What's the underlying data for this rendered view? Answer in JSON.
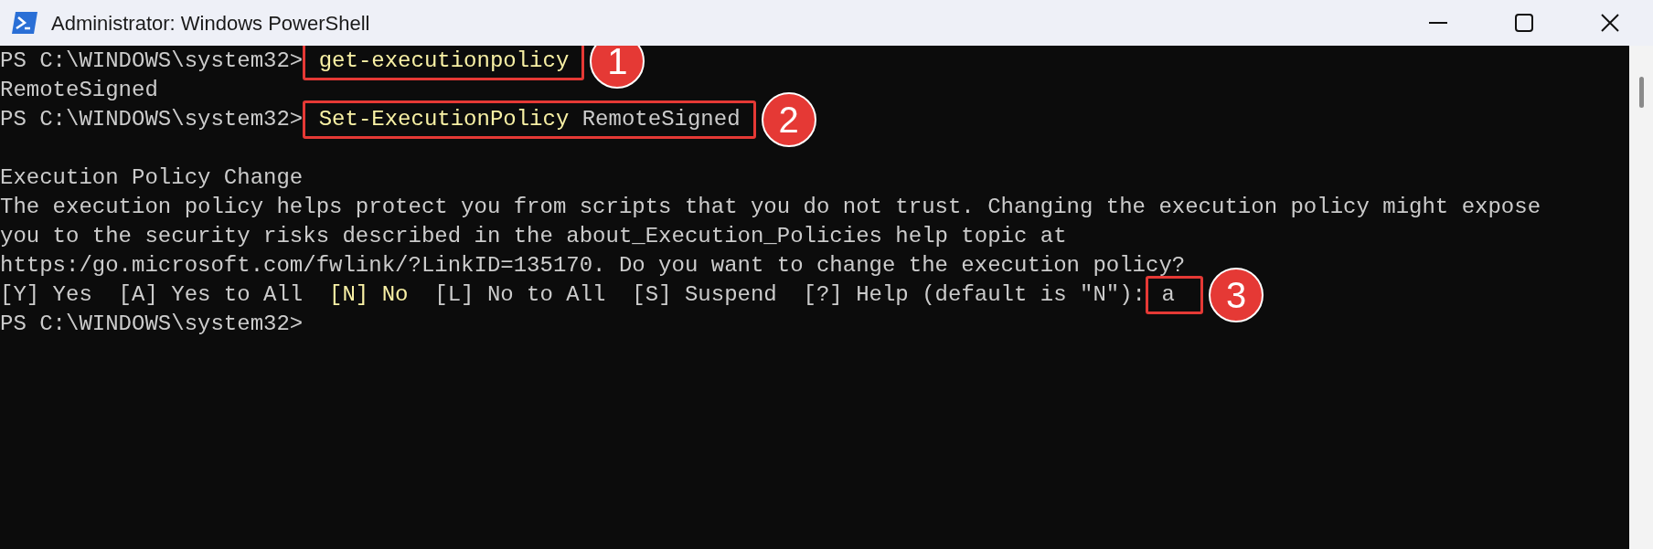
{
  "window": {
    "title": "Administrator: Windows PowerShell"
  },
  "terminal": {
    "lines": [
      {
        "kind": "text",
        "segments": [
          {
            "text": "PS C:\\WINDOWS\\system32>",
            "highlight": false
          }
        ],
        "callout": {
          "number": "1",
          "segments": [
            {
              "text": " get-executionpolicy",
              "highlight": true
            }
          ]
        }
      },
      {
        "kind": "text",
        "segments": [
          {
            "text": "RemoteSigned",
            "highlight": false
          }
        ]
      },
      {
        "kind": "text",
        "segments": [
          {
            "text": "PS C:\\WINDOWS\\system32>",
            "highlight": false
          }
        ],
        "callout": {
          "number": "2",
          "segments": [
            {
              "text": " Set-ExecutionPolicy ",
              "highlight": true
            },
            {
              "text": "RemoteSigned",
              "highlight": false
            }
          ]
        }
      },
      {
        "kind": "blank"
      },
      {
        "kind": "text",
        "segments": [
          {
            "text": "Execution Policy Change",
            "highlight": false
          }
        ]
      },
      {
        "kind": "text",
        "segments": [
          {
            "text": "The execution policy helps protect you from scripts that you do not trust. Changing the execution policy might expose",
            "highlight": false
          }
        ]
      },
      {
        "kind": "text",
        "segments": [
          {
            "text": "you to the security risks described in the about_Execution_Policies help topic at",
            "highlight": false
          }
        ]
      },
      {
        "kind": "text",
        "segments": [
          {
            "text": "https:/go.microsoft.com/fwlink/?LinkID=135170. Do you want to change the execution policy?",
            "highlight": false
          }
        ]
      },
      {
        "kind": "text",
        "segments": [
          {
            "text": "[Y] Yes  [A] Yes to All  ",
            "highlight": false
          },
          {
            "text": "[N] No",
            "highlight": true
          },
          {
            "text": "  [L] No to All  [S] Suspend  [?] Help (default is \"N\"):",
            "highlight": false
          }
        ],
        "callout": {
          "number": "3",
          "segments": [
            {
              "text": " a ",
              "highlight": false
            }
          ]
        }
      },
      {
        "kind": "text",
        "segments": [
          {
            "text": "PS C:\\WINDOWS\\system32>",
            "highlight": false
          }
        ]
      }
    ]
  }
}
